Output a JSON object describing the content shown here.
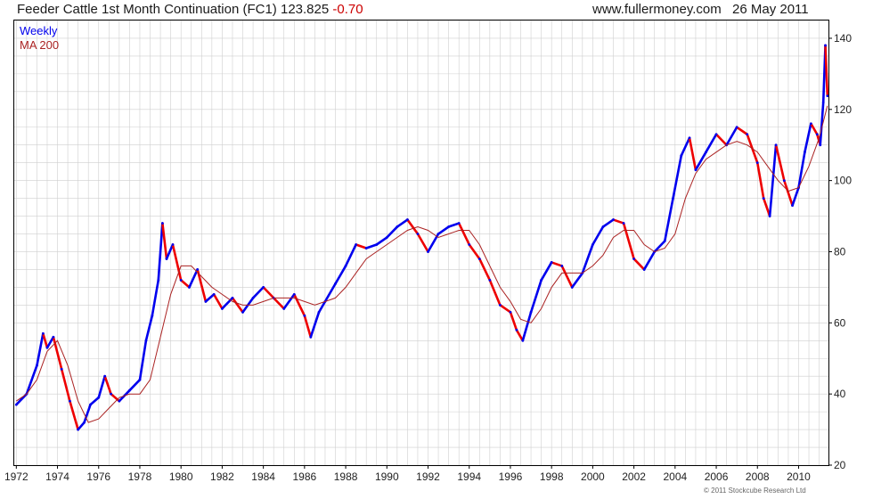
{
  "header": {
    "title": "Feeder Cattle 1st Month Continuation (FC1) 123.825",
    "change": "-0.70",
    "site": "www.fullermoney.com",
    "date": "26 May 2011"
  },
  "footer": {
    "copyright": "© 2011 Stockcube Research Ltd"
  },
  "colors": {
    "up": "#0000ee",
    "down": "#ee0000",
    "ma": "#aa2222",
    "grid": "#cfcfcf",
    "frame": "#000000"
  },
  "chart_data": {
    "type": "line",
    "title": "Feeder Cattle 1st Month Continuation (FC1) 123.825",
    "legend": [
      "Weekly",
      "MA 200"
    ],
    "legend_position": "top-left",
    "grid": true,
    "xlim": [
      1971.9,
      2011.45
    ],
    "ylim": [
      20,
      145
    ],
    "x_ticks": [
      "1972",
      "1974",
      "1976",
      "1978",
      "1980",
      "1982",
      "1984",
      "1986",
      "1988",
      "1990",
      "1992",
      "1994",
      "1996",
      "1998",
      "2000",
      "2002",
      "2004",
      "2006",
      "2008",
      "2010"
    ],
    "y_ticks": [
      "20",
      "40",
      "60",
      "80",
      "100",
      "120",
      "140"
    ],
    "series": [
      {
        "name": "Weekly",
        "x": [
          1972.0,
          1972.5,
          1973.0,
          1973.3,
          1973.5,
          1973.8,
          1974.2,
          1974.6,
          1975.0,
          1975.3,
          1975.6,
          1976.0,
          1976.3,
          1976.6,
          1977.0,
          1977.5,
          1978.0,
          1978.3,
          1978.6,
          1978.9,
          1979.1,
          1979.3,
          1979.6,
          1980.0,
          1980.4,
          1980.8,
          1981.2,
          1981.6,
          1982.0,
          1982.5,
          1983.0,
          1983.5,
          1984.0,
          1984.5,
          1985.0,
          1985.5,
          1986.0,
          1986.3,
          1986.7,
          1987.0,
          1987.5,
          1988.0,
          1988.5,
          1989.0,
          1989.5,
          1990.0,
          1990.5,
          1991.0,
          1991.5,
          1992.0,
          1992.5,
          1993.0,
          1993.5,
          1994.0,
          1994.5,
          1995.0,
          1995.5,
          1996.0,
          1996.3,
          1996.6,
          1997.0,
          1997.5,
          1998.0,
          1998.5,
          1999.0,
          1999.5,
          2000.0,
          2000.5,
          2001.0,
          2001.5,
          2002.0,
          2002.5,
          2003.0,
          2003.5,
          2003.9,
          2004.3,
          2004.7,
          2005.0,
          2005.5,
          2006.0,
          2006.5,
          2007.0,
          2007.5,
          2008.0,
          2008.3,
          2008.6,
          2008.9,
          2009.3,
          2009.7,
          2010.0,
          2010.3,
          2010.6,
          2010.9,
          2011.05,
          2011.2,
          2011.3,
          2011.4
        ],
        "y": [
          37,
          40,
          48,
          57,
          53,
          56,
          47,
          38,
          30,
          32,
          37,
          39,
          45,
          40,
          38,
          41,
          44,
          55,
          62,
          72,
          88,
          78,
          82,
          72,
          70,
          75,
          66,
          68,
          64,
          67,
          63,
          67,
          70,
          67,
          64,
          68,
          62,
          56,
          63,
          66,
          71,
          76,
          82,
          81,
          82,
          84,
          87,
          89,
          85,
          80,
          85,
          87,
          88,
          82,
          78,
          72,
          65,
          63,
          58,
          55,
          63,
          72,
          77,
          76,
          70,
          74,
          82,
          87,
          89,
          88,
          78,
          75,
          80,
          83,
          95,
          107,
          112,
          103,
          108,
          113,
          110,
          115,
          113,
          105,
          95,
          90,
          110,
          100,
          93,
          98,
          108,
          116,
          113,
          110,
          122,
          138,
          123.8
        ],
        "color": "#0000ee"
      },
      {
        "name": "MA 200",
        "x": [
          1972.0,
          1972.5,
          1973.0,
          1973.5,
          1974.0,
          1974.5,
          1975.0,
          1975.5,
          1976.0,
          1976.5,
          1977.0,
          1977.5,
          1978.0,
          1978.5,
          1979.0,
          1979.5,
          1980.0,
          1980.5,
          1981.0,
          1981.5,
          1982.0,
          1982.5,
          1983.0,
          1983.5,
          1984.0,
          1984.5,
          1985.0,
          1985.5,
          1986.0,
          1986.5,
          1987.0,
          1987.5,
          1988.0,
          1988.5,
          1989.0,
          1989.5,
          1990.0,
          1990.5,
          1991.0,
          1991.5,
          1992.0,
          1992.5,
          1993.0,
          1993.5,
          1994.0,
          1994.5,
          1995.0,
          1995.5,
          1996.0,
          1996.5,
          1997.0,
          1997.5,
          1998.0,
          1998.5,
          1999.0,
          1999.5,
          2000.0,
          2000.5,
          2001.0,
          2001.5,
          2002.0,
          2002.5,
          2003.0,
          2003.5,
          2004.0,
          2004.5,
          2005.0,
          2005.5,
          2006.0,
          2006.5,
          2007.0,
          2007.5,
          2008.0,
          2008.5,
          2009.0,
          2009.5,
          2010.0,
          2010.5,
          2011.0,
          2011.4
        ],
        "y": [
          38,
          40,
          44,
          52,
          55,
          48,
          38,
          32,
          33,
          36,
          39,
          40,
          40,
          44,
          56,
          68,
          76,
          76,
          73,
          70,
          68,
          66,
          65,
          65,
          66,
          67,
          67,
          67,
          66,
          65,
          66,
          67,
          70,
          74,
          78,
          80,
          82,
          84,
          86,
          87,
          86,
          84,
          85,
          86,
          86,
          82,
          76,
          70,
          66,
          61,
          60,
          64,
          70,
          74,
          74,
          74,
          76,
          79,
          84,
          86,
          86,
          82,
          80,
          81,
          85,
          95,
          102,
          106,
          108,
          110,
          111,
          110,
          108,
          104,
          100,
          97,
          98,
          104,
          112,
          121
        ],
        "color": "#aa2222"
      }
    ]
  }
}
